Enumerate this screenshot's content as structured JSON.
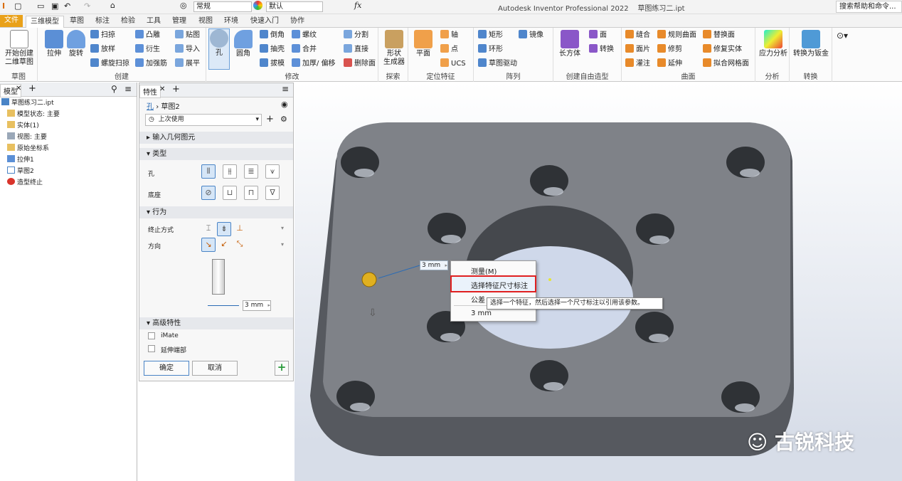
{
  "qat": {
    "style_combo": "常规",
    "appearance_combo": "默认",
    "fx": "fx",
    "app_title": "Autodesk Inventor Professional 2022",
    "doc_title": "草图练习二.ipt",
    "search_placeholder": "搜索帮助和命令..."
  },
  "tabs": [
    "文件",
    "三维模型",
    "草图",
    "标注",
    "检验",
    "工具",
    "管理",
    "视图",
    "环境",
    "快速入门",
    "协作"
  ],
  "ribbon": {
    "sketch": {
      "label": "草图",
      "start": "开始创建",
      "start2": "二维草图"
    },
    "create": {
      "label": "创建",
      "extrude": "拉伸",
      "revolve": "旋转",
      "sweep": "扫掠",
      "loft": "放样",
      "coil": "螺旋扫掠",
      "emboss": "凸雕",
      "derive": "衍生",
      "rib": "加强筋",
      "decal": "贴图",
      "import": "导入",
      "unwrap": "展平"
    },
    "modify": {
      "label": "修改",
      "hole": "孔",
      "fillet": "圆角",
      "chamfer": "倒角",
      "shell": "抽壳",
      "draft": "拔模",
      "thread": "螺纹",
      "combine": "合并",
      "thicken": "加厚/ 偏移",
      "split": "分割",
      "direct": "直接",
      "delete_face": "删除面"
    },
    "explore": {
      "label": "探索",
      "shape_gen": "形状",
      "shape_gen2": "生成器"
    },
    "workfeat": {
      "label": "定位特征",
      "plane": "平面",
      "axis": "轴",
      "point": "点",
      "ucs": "UCS"
    },
    "pattern": {
      "label": "阵列",
      "rect": "矩形",
      "circ": "环形",
      "sketch_driven": "草图驱动",
      "mirror": "镜像"
    },
    "freeform": {
      "label": "创建自由造型",
      "box": "长方体",
      "face": "面",
      "convert": "转换"
    },
    "surface": {
      "label": "曲面",
      "stitch": "缝合",
      "patch": "面片",
      "sculpt": "灌注",
      "ruled": "规则曲面",
      "trim": "修剪",
      "extend": "延伸",
      "replace": "替换面",
      "repair": "修复实体",
      "fit_mesh": "拟合网格面"
    },
    "analysis": {
      "label": "分析",
      "stress": "应力分析"
    },
    "convert": {
      "label": "转换",
      "to_sheetmetal": "转换为钣金"
    }
  },
  "model_panel": {
    "tab": "模型",
    "items": [
      "草图练习二.ipt",
      "模型状态: 主要",
      "实体(1)",
      "视图: 主要",
      "原始坐标系",
      "拉伸1",
      "草图2",
      "造型终止"
    ]
  },
  "props": {
    "tab": "特性",
    "feature": "孔",
    "sketch": "草图2",
    "preset": "上次使用",
    "sections": {
      "input": "输入几何图元",
      "type": "类型",
      "behavior": "行为",
      "advanced": "高级特性"
    },
    "hole_label": "孔",
    "seat_label": "底座",
    "termination_label": "终止方式",
    "direction_label": "方向",
    "depth_value": "3 mm",
    "imate": "iMate",
    "extend_start": "延伸端部",
    "ok": "确定",
    "cancel": "取消"
  },
  "viewport": {
    "dim_value": "3 mm",
    "menu": [
      "测量(M)",
      "选择特征尺寸标注",
      "公差",
      "3 mm"
    ],
    "tooltip": "选择一个特征，然后选择一个尺寸标注以引用该参数。",
    "watermark": "古锐科技"
  }
}
